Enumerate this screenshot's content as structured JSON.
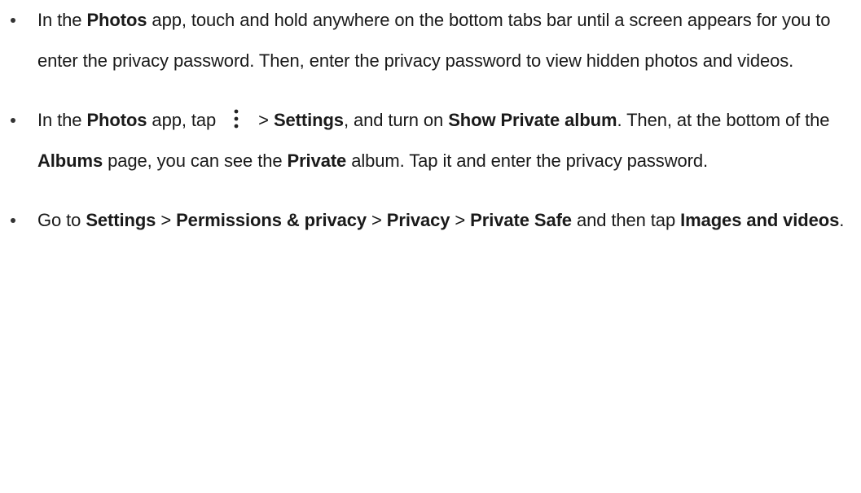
{
  "bullets": [
    {
      "segments": [
        {
          "text": "In the ",
          "bold": false
        },
        {
          "text": "Photos",
          "bold": true
        },
        {
          "text": " app, touch and hold anywhere on the bottom tabs bar until a screen appears for you to enter the privacy password. Then, enter the privacy password to view hidden photos and videos.",
          "bold": false
        }
      ]
    },
    {
      "segments": [
        {
          "text": "In the ",
          "bold": false
        },
        {
          "text": "Photos",
          "bold": true
        },
        {
          "text": " app, tap ",
          "bold": false
        },
        {
          "icon": "more-vertical-icon"
        },
        {
          "text": " > ",
          "bold": false
        },
        {
          "text": "Settings",
          "bold": true
        },
        {
          "text": ", and turn on ",
          "bold": false
        },
        {
          "text": "Show Private album",
          "bold": true
        },
        {
          "text": ". Then, at the bottom of the ",
          "bold": false
        },
        {
          "text": "Albums",
          "bold": true
        },
        {
          "text": " page, you can see the ",
          "bold": false
        },
        {
          "text": "Private",
          "bold": true
        },
        {
          "text": " album. Tap it and enter the privacy password.",
          "bold": false
        }
      ]
    },
    {
      "segments": [
        {
          "text": "Go to ",
          "bold": false
        },
        {
          "text": "Settings",
          "bold": true
        },
        {
          "text": " > ",
          "bold": false
        },
        {
          "text": "Permissions & privacy",
          "bold": true
        },
        {
          "text": " > ",
          "bold": false
        },
        {
          "text": "Privacy",
          "bold": true
        },
        {
          "text": " > ",
          "bold": false
        },
        {
          "text": "Private Safe",
          "bold": true
        },
        {
          "text": " and then tap ",
          "bold": false
        },
        {
          "text": "Images and videos",
          "bold": true
        },
        {
          "text": ".",
          "bold": false
        }
      ]
    }
  ]
}
